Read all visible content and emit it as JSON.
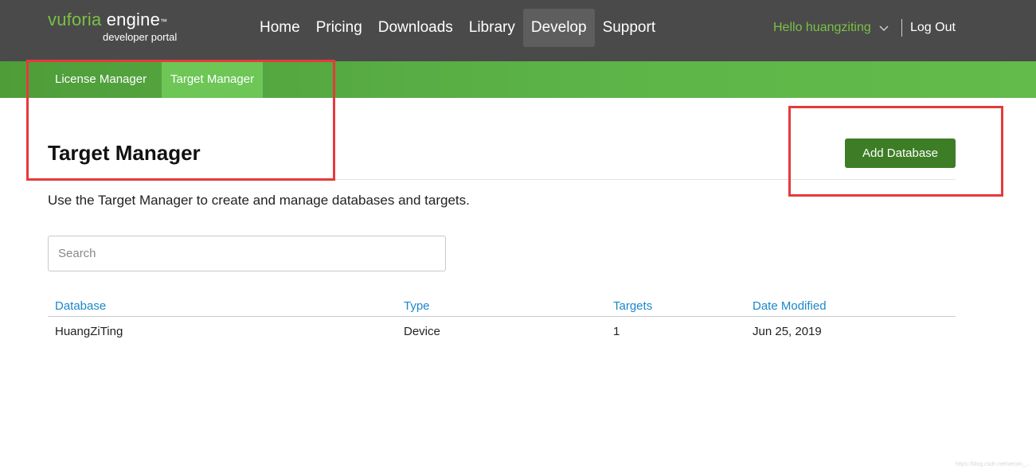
{
  "header": {
    "logo": {
      "brand_prefix": "vuforia",
      "brand_suffix": " engine",
      "trademark": "™",
      "subtitle": "developer portal"
    },
    "nav": [
      {
        "label": "Home"
      },
      {
        "label": "Pricing"
      },
      {
        "label": "Downloads"
      },
      {
        "label": "Library"
      },
      {
        "label": "Develop",
        "active": true
      },
      {
        "label": "Support"
      }
    ],
    "user_greeting": "Hello huangziting",
    "logout_label": "Log Out"
  },
  "subnav": {
    "items": [
      {
        "label": "License Manager"
      },
      {
        "label": "Target Manager",
        "active": true
      }
    ]
  },
  "page": {
    "title": "Target Manager",
    "add_button_label": "Add Database",
    "description": "Use the Target Manager to create and manage databases and targets.",
    "search": {
      "placeholder": "Search",
      "value": ""
    }
  },
  "table": {
    "columns": [
      "Database",
      "Type",
      "Targets",
      "Date Modified"
    ],
    "rows": [
      [
        "HuangZiTing",
        "Device",
        "1",
        "Jun 25, 2019"
      ]
    ]
  },
  "watermark": "https://blog.csdn.net/weixin_...",
  "colors": {
    "header_bg": "#4a4a4b",
    "accent_green": "#7ac143",
    "subnav_green": "#5db548",
    "button_green": "#3d7d26",
    "link_blue": "#1b87c9",
    "annotation_red": "#e63a3a"
  }
}
